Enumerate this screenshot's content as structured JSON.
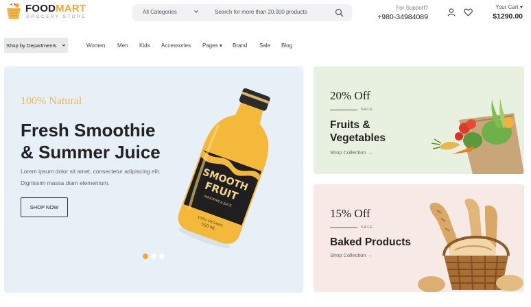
{
  "header": {
    "logo": {
      "brand_a": "FOOD",
      "brand_b": "MART",
      "tagline": "GROCERY STORE"
    },
    "search": {
      "category": "All Categories",
      "placeholder": "Search for more than 20,000 products"
    },
    "support": {
      "label": "For Support?",
      "phone": "+980-34984089"
    },
    "cart": {
      "label": "Your Cart ▾",
      "amount": "$1290.00"
    }
  },
  "nav": {
    "departments": "Shop by Departments",
    "items": [
      "Women",
      "Men",
      "Kids",
      "Accessories",
      "Pages ▾",
      "Brand",
      "Sale",
      "Blog"
    ]
  },
  "hero": {
    "eyebrow": "100% Natural",
    "title_line1": "Fresh Smoothie",
    "title_line2": "& Summer Juice",
    "desc_line1": "Lorem ipsum dolor sit amet, consectetur adipiscing elit.",
    "desc_line2": "Dignissim massa diam elementum.",
    "button": "SHOP NOW",
    "bottle_label": {
      "line1": "SMOOTH",
      "line2": "FRUIT",
      "line3": "SMOOTHIE & JUICE",
      "line4": "100% ORGANIC",
      "line5": "500 ML"
    },
    "slides_total": 3,
    "active_slide": 1
  },
  "promos": [
    {
      "discount": "20% Off",
      "sale": "SALE",
      "title_line1": "Fruits &",
      "title_line2": "Vegetables",
      "link": "Shop Collection →"
    },
    {
      "discount": "15% Off",
      "sale": "SALE",
      "title_line1": "Baked Products",
      "link": "Shop Collection →"
    }
  ],
  "colors": {
    "accent": "#f2a735",
    "hero_bg": "#e7eff7",
    "promo_green": "#e8f0e0",
    "promo_pink": "#f6e9e6"
  },
  "icons": [
    "basket-icon",
    "chevron-down-icon",
    "search-icon",
    "user-icon",
    "heart-icon"
  ]
}
